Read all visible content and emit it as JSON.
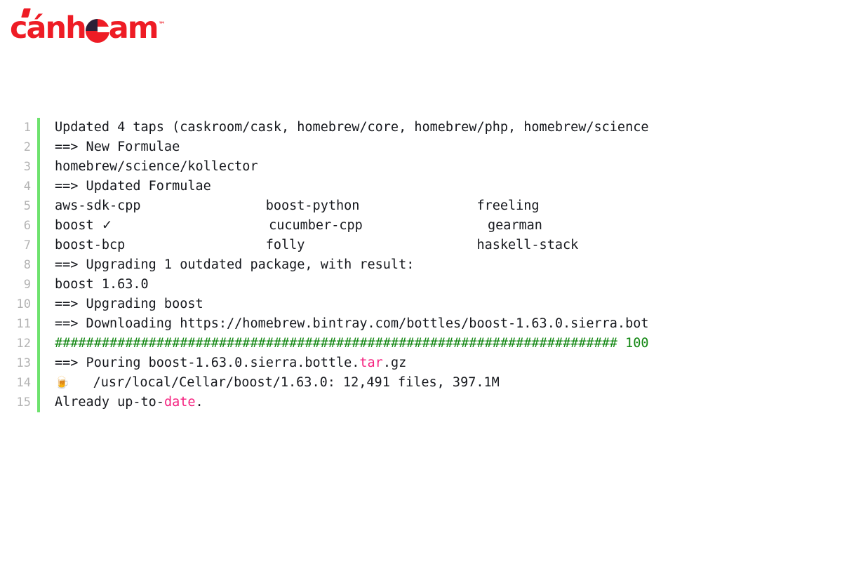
{
  "brand": {
    "name": "cánheam",
    "name_prefix": "cánh",
    "name_suffix": "am",
    "trademark": "™",
    "color": "#ee1c25",
    "accent_color": "#2b2038",
    "logo_icon": "canheam-logo"
  },
  "code": {
    "gutter_rail_color": "#6ee26e",
    "text_color": "#16181d",
    "line_number_color": "#b3b3b3",
    "token_colors": {
      "green": "#128712",
      "pink": "#f5217f"
    },
    "language": "shell",
    "lines": [
      {
        "number": "1",
        "text": "Updated 4 taps (caskroom/cask, homebrew/core, homebrew/php, homebrew/science",
        "spans": [
          {
            "t": "Updated 4 taps (caskroom/cask, homebrew/core, homebrew/php, homebrew/science",
            "c": ""
          }
        ]
      },
      {
        "number": "2",
        "text": "==> New Formulae",
        "spans": [
          {
            "t": "==> New Formulae",
            "c": ""
          }
        ]
      },
      {
        "number": "3",
        "text": "homebrew/science/kollector",
        "spans": [
          {
            "t": "homebrew/science/kollector",
            "c": ""
          }
        ]
      },
      {
        "number": "4",
        "text": "==> Updated Formulae",
        "spans": [
          {
            "t": "==> Updated Formulae",
            "c": ""
          }
        ]
      },
      {
        "number": "5",
        "text": "aws-sdk-cpp                boost-python               freeling",
        "spans": [
          {
            "t": "aws-sdk-cpp                boost-python               freeling",
            "c": ""
          }
        ]
      },
      {
        "number": "6",
        "text": "boost ✓                     cucumber-cpp                gearman",
        "spans": [
          {
            "t": "boost ",
            "c": ""
          },
          {
            "t": "✓",
            "c": "check"
          },
          {
            "t": "                    cucumber-cpp                gearman",
            "c": ""
          }
        ]
      },
      {
        "number": "7",
        "text": "boost-bcp                  folly                      haskell-stack",
        "spans": [
          {
            "t": "boost-bcp                  folly                      haskell-stack",
            "c": ""
          }
        ]
      },
      {
        "number": "8",
        "text": "==> Upgrading 1 outdated package, with result:",
        "spans": [
          {
            "t": "==> Upgrading 1 outdated package, with result:",
            "c": ""
          }
        ]
      },
      {
        "number": "9",
        "text": "boost 1.63.0",
        "spans": [
          {
            "t": "boost 1.63.0",
            "c": ""
          }
        ]
      },
      {
        "number": "10",
        "text": "==> Upgrading boost",
        "spans": [
          {
            "t": "==> Upgrading boost",
            "c": ""
          }
        ]
      },
      {
        "number": "11",
        "text": "==> Downloading https://homebrew.bintray.com/bottles/boost-1.63.0.sierra.bot",
        "spans": [
          {
            "t": "==> Downloading https://homebrew.bintray.com/bottles/boost-1.63.0.sierra.bot",
            "c": ""
          }
        ]
      },
      {
        "number": "12",
        "text": "######################################################################## 100",
        "spans": [
          {
            "t": "######################################################################## 100",
            "c": "green"
          }
        ]
      },
      {
        "number": "13",
        "text": "==> Pouring boost-1.63.0.sierra.bottle.tar.gz",
        "spans": [
          {
            "t": "==> Pouring boost-1.63.0.sierra.bottle.",
            "c": ""
          },
          {
            "t": "tar",
            "c": "pink"
          },
          {
            "t": ".gz",
            "c": ""
          }
        ]
      },
      {
        "number": "14",
        "text": "🍺  /usr/local/Cellar/boost/1.63.0: 12,491 files, 397.1M",
        "spans": [
          {
            "t": "🍺",
            "c": "emoji"
          },
          {
            "t": "   /usr/local/Cellar/boost/1.63.0: 12,491 files, 397.1M",
            "c": ""
          }
        ]
      },
      {
        "number": "15",
        "text": "Already up-to-date.",
        "spans": [
          {
            "t": "Already up-to-",
            "c": ""
          },
          {
            "t": "date",
            "c": "pink"
          },
          {
            "t": ".",
            "c": ""
          }
        ]
      }
    ]
  }
}
